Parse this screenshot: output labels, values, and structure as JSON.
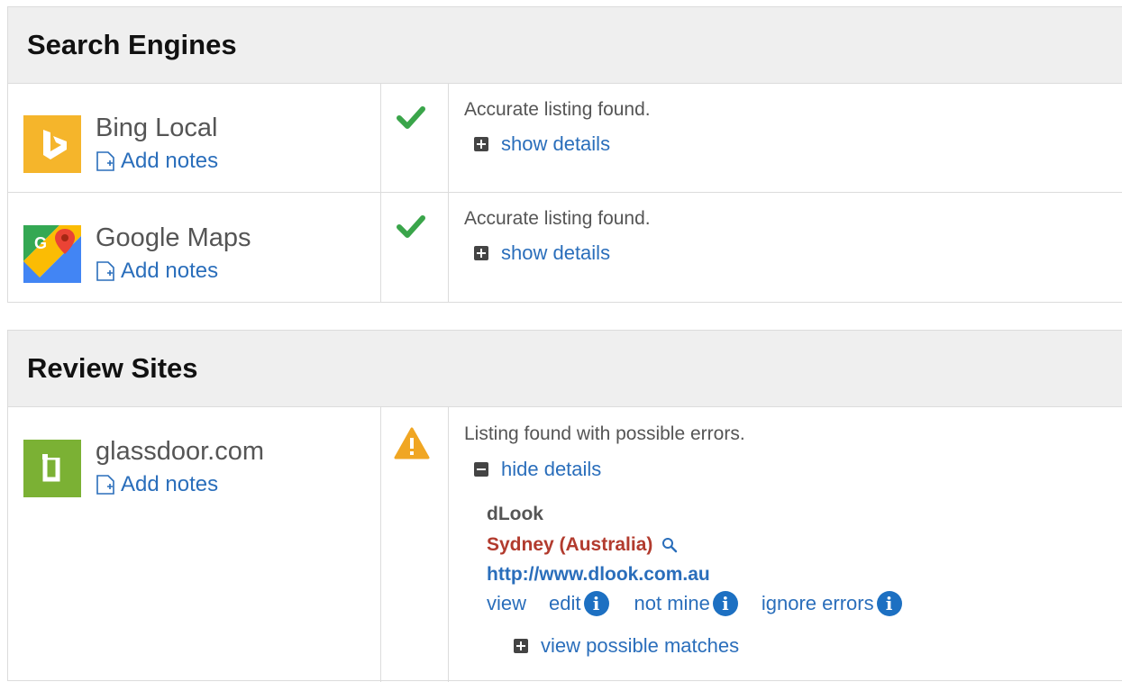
{
  "search_engines": {
    "title": "Search Engines",
    "rows": [
      {
        "name": "Bing Local",
        "add_notes": "Add notes",
        "status_message": "Accurate listing found.",
        "toggle_label": "show details",
        "logo_color": "#f5b52b"
      },
      {
        "name": "Google Maps",
        "add_notes": "Add notes",
        "status_message": "Accurate listing found.",
        "toggle_label": "show details"
      }
    ]
  },
  "review_sites": {
    "title": "Review Sites",
    "rows": [
      {
        "name": "glassdoor.com",
        "add_notes": "Add notes",
        "status_message": "Listing found with possible errors.",
        "toggle_label": "hide details",
        "logo_color": "#7bb134",
        "details": {
          "business_name": "dLook",
          "location": "Sydney (Australia)",
          "url": "http://www.dlook.com.au",
          "actions": {
            "view": "view",
            "edit": "edit",
            "not_mine": "not mine",
            "ignore_errors": "ignore errors"
          },
          "matches_label": "view possible matches"
        }
      }
    ]
  },
  "colors": {
    "link": "#2a6ebb",
    "check": "#3aa54a",
    "warning": "#f0a623",
    "location": "#b23b2e",
    "info": "#1d70c2"
  }
}
